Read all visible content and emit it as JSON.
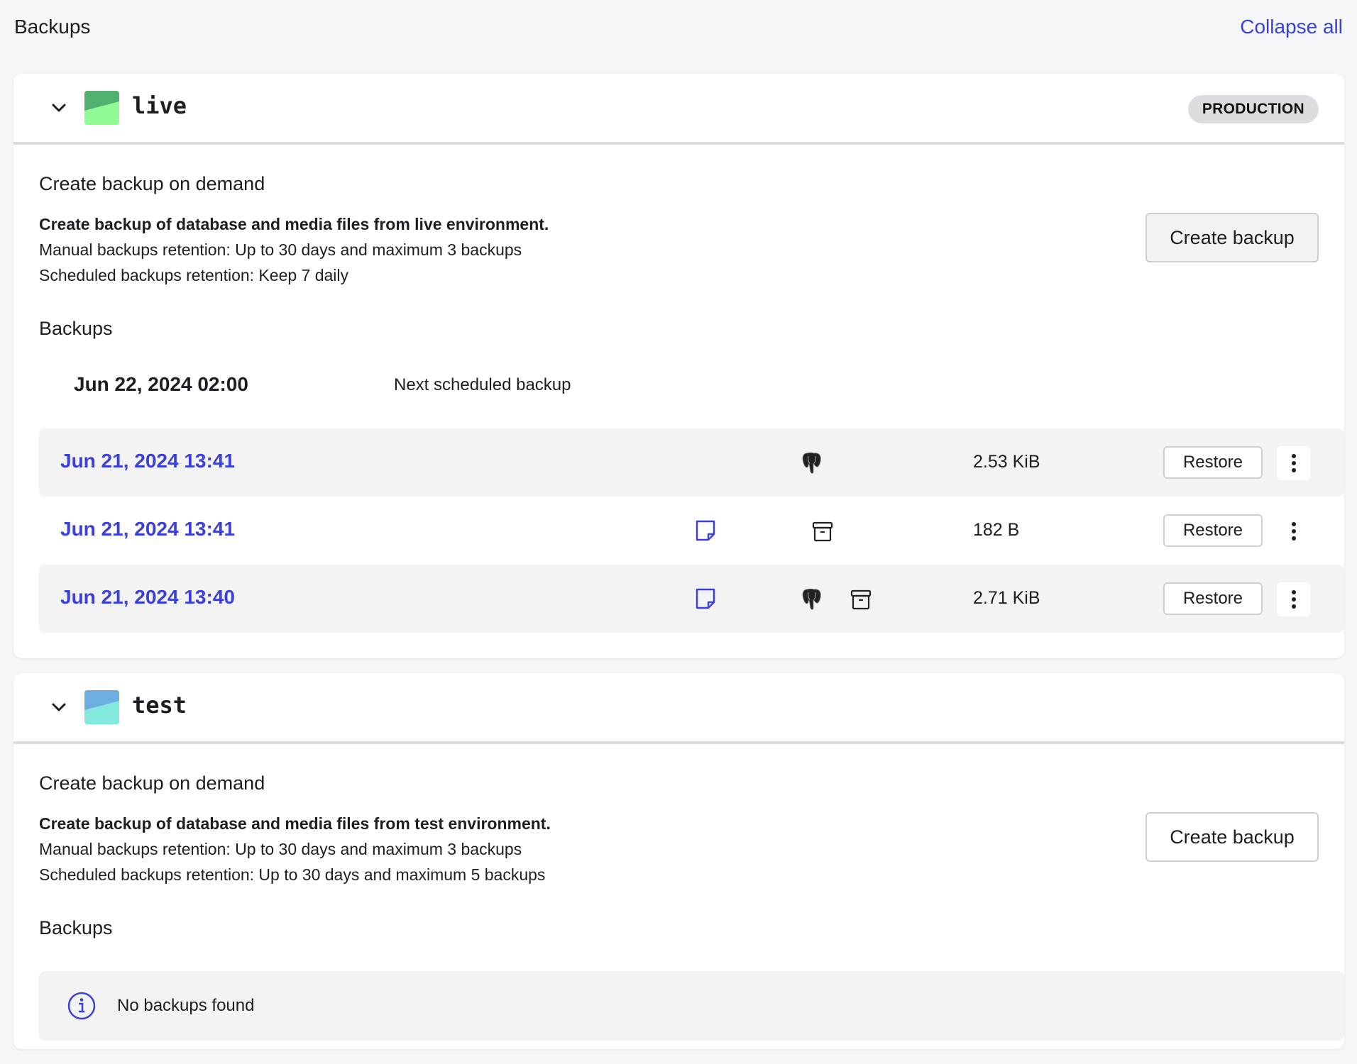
{
  "page": {
    "title": "Backups",
    "collapse_all_label": "Collapse all"
  },
  "colors": {
    "accent": "#3b3fdb",
    "live_icon_top": "#52b06e",
    "live_icon_bottom": "#90fb95",
    "test_icon_top": "#6daee0",
    "test_icon_bottom": "#85e8dc"
  },
  "environments": [
    {
      "name": "live",
      "badge": "PRODUCTION",
      "expanded": true,
      "create_section": {
        "title": "Create backup on demand",
        "description": "Create backup of database and media files from live environment.",
        "manual_retention": "Manual backups retention: Up to 30 days and maximum 3 backups",
        "scheduled_retention": "Scheduled backups retention: Keep 7 daily",
        "button_label": "Create backup"
      },
      "backups_title": "Backups",
      "next_scheduled": {
        "date": "Jun 22, 2024 02:00",
        "label": "Next scheduled backup"
      },
      "backups": [
        {
          "date": "Jun 21, 2024 13:41",
          "has_note": false,
          "has_database": true,
          "has_media": false,
          "size": "2.53 KiB",
          "restore_label": "Restore",
          "icons": [
            "postgresql-icon"
          ]
        },
        {
          "date": "Jun 21, 2024 13:41",
          "has_note": true,
          "has_database": false,
          "has_media": true,
          "size": "182 B",
          "restore_label": "Restore",
          "icons": [
            "note-icon",
            "archive-icon"
          ]
        },
        {
          "date": "Jun 21, 2024 13:40",
          "has_note": true,
          "has_database": true,
          "has_media": true,
          "size": "2.71 KiB",
          "restore_label": "Restore",
          "icons": [
            "note-icon",
            "postgresql-icon",
            "archive-icon"
          ]
        }
      ]
    },
    {
      "name": "test",
      "badge": "",
      "expanded": true,
      "create_section": {
        "title": "Create backup on demand",
        "description": "Create backup of database and media files from test environment.",
        "manual_retention": "Manual backups retention: Up to 30 days and maximum 3 backups",
        "scheduled_retention": "Scheduled backups retention: Up to 30 days and maximum 5 backups",
        "button_label": "Create backup"
      },
      "backups_title": "Backups",
      "empty_message": "No backups found"
    }
  ]
}
